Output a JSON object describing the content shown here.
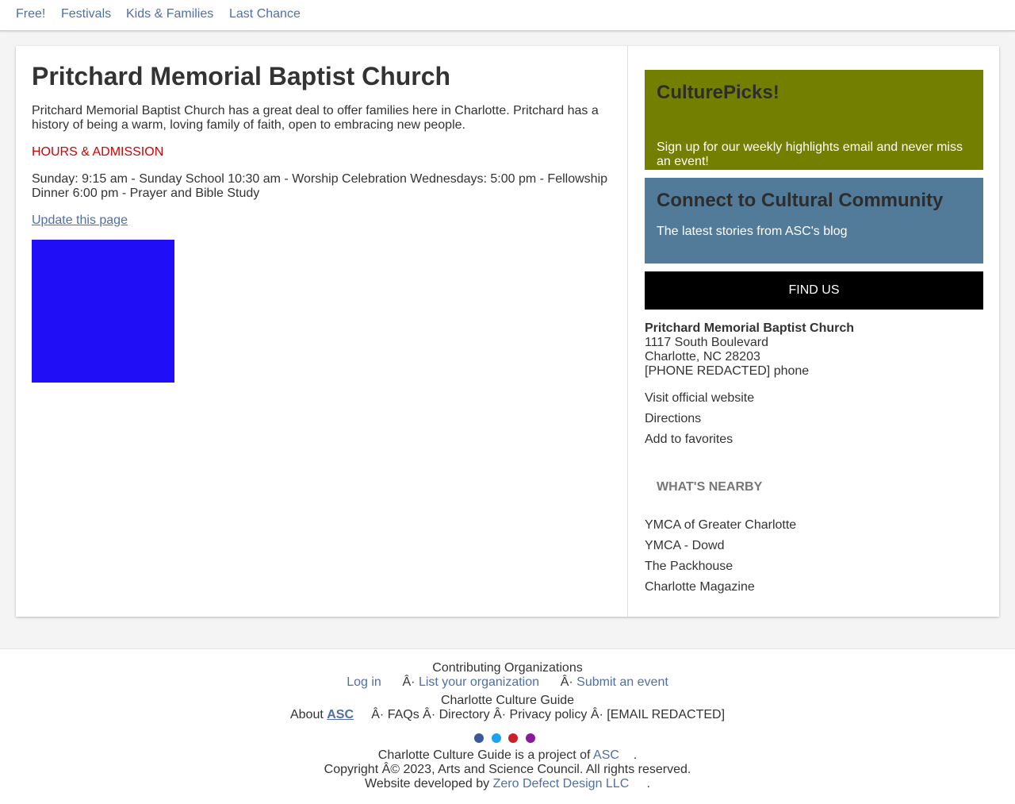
{
  "nav": [
    "Free!",
    "Festivals",
    "Kids & Families",
    "Last Chance"
  ],
  "main": {
    "title": "Pritchard Memorial Baptist Church",
    "intro": "Pritchard Memorial Baptist Church has a great deal to offer families here in Charlotte. Pritchard has a history of being a warm, loving family of faith, open to embracing new people.",
    "hours_heading": "HOURS & ADMISSION",
    "hours": "Sunday: 9:15 am - Sunday School 10:30 am - Worship Celebration Wednesdays: 5:00 pm - Fellowship Dinner 6:00 pm - Prayer and Bible Study",
    "update_link": "Update this page",
    "image_color": "#200ff6"
  },
  "sidebar": {
    "picks": {
      "title": "CulturePicks!",
      "text": "Sign up for our weekly highlights email and never miss an event!",
      "color": "#727f00"
    },
    "connect": {
      "title": "Connect to Cultural Community",
      "text": "The latest stories from ASC's blog",
      "color": "#527b99"
    },
    "find_us": "FIND US",
    "address": {
      "name": "Pritchard Memorial Baptist Church",
      "street": "1117 South Boulevard",
      "city": "Charlotte, NC 28203",
      "phone": "[PHONE REDACTED] phone"
    },
    "links": [
      "Visit official website",
      "Directions",
      "Add to favorites"
    ],
    "nearby_heading": "WHAT'S NEARBY",
    "nearby": [
      "YMCA of Greater Charlotte",
      "YMCA - Dowd",
      "The Packhouse",
      "Charlotte Magazine"
    ]
  },
  "footer": {
    "contrib_heading": "Contributing Organizations",
    "login": "Log in",
    "sep": "Â·",
    "list_org": "List your organization",
    "submit_event": "Submit an event",
    "guide_heading": "Charlotte Culture Guide",
    "about": "About",
    "asc": "ASC",
    "faqs": "FAQs",
    "directory": "Directory",
    "privacy": "Privacy policy",
    "email": "[EMAIL REDACTED]",
    "social_icons": [
      {
        "name": "facebook-icon",
        "color": "#3b5998"
      },
      {
        "name": "twitter-icon",
        "color": "#1da1f2"
      },
      {
        "name": "pinterest-icon",
        "color": "#cb2027"
      },
      {
        "name": "instagram-icon",
        "color": "#8a1a9b"
      }
    ],
    "project_text": "Charlotte Culture Guide is a project of",
    "project_link": "ASC",
    "period": ".",
    "copyright": "Copyright Â© 2023, Arts and Science Council. All rights reserved.",
    "developed_text": "Website developed by",
    "developed_link": "Zero Defect Design LLC"
  }
}
